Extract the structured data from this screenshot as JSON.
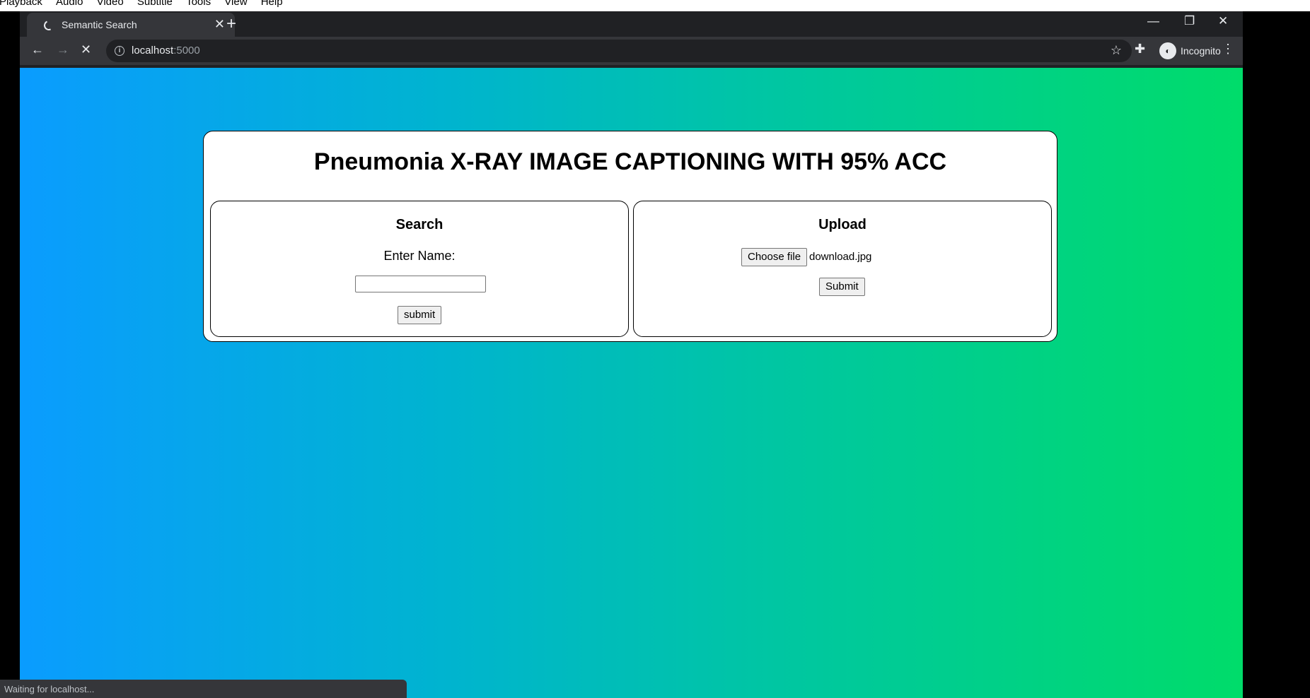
{
  "player_menu": [
    "Playback",
    "Audio",
    "Video",
    "Subtitle",
    "Tools",
    "View",
    "Help"
  ],
  "browser": {
    "tab_title": "Semantic Search",
    "url_host": "localhost",
    "url_port": ":5000",
    "profile_label": "Incognito",
    "status_text": "Waiting for localhost..."
  },
  "page": {
    "heading": "Pneumonia X-RAY IMAGE CAPTIONING WITH 95% ACC",
    "search": {
      "title": "Search",
      "label": "Enter Name:",
      "input_value": "",
      "submit_label": "submit"
    },
    "upload": {
      "title": "Upload",
      "choose_label": "Choose file",
      "file_name": "download.jpg",
      "submit_label": "Submit"
    }
  },
  "colors": {
    "gradient_start": "#0a9cff",
    "gradient_end": "#00dc6a",
    "chrome_dark": "#202124",
    "chrome_toolbar": "#35363a"
  }
}
